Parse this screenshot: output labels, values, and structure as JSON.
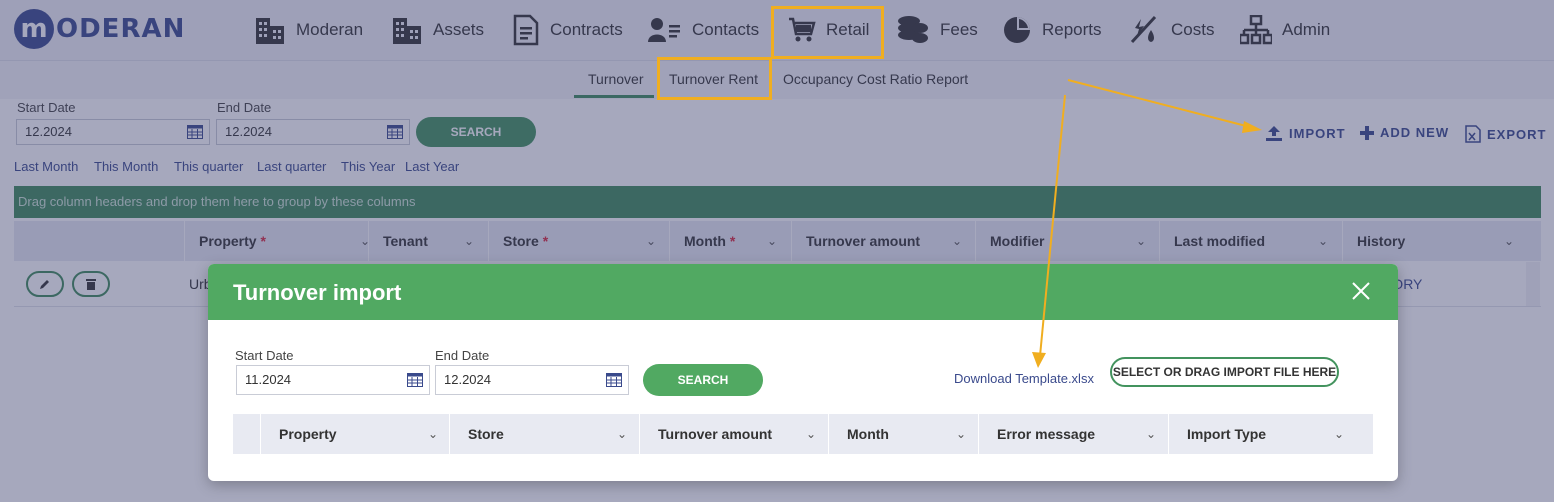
{
  "app": {
    "logo_letter": "m",
    "logo_text": "ODERAN"
  },
  "nav": {
    "items": [
      {
        "label": "Moderan",
        "icon": "building-icon"
      },
      {
        "label": "Assets",
        "icon": "building-icon"
      },
      {
        "label": "Contracts",
        "icon": "document-icon"
      },
      {
        "label": "Contacts",
        "icon": "contacts-icon"
      },
      {
        "label": "Retail",
        "icon": "cart-icon"
      },
      {
        "label": "Fees",
        "icon": "coins-icon"
      },
      {
        "label": "Reports",
        "icon": "pie-chart-icon"
      },
      {
        "label": "Costs",
        "icon": "costs-icon"
      },
      {
        "label": "Admin",
        "icon": "org-chart-icon"
      }
    ]
  },
  "subnav": {
    "tabs": [
      {
        "label": "Turnover",
        "active": true
      },
      {
        "label": "Turnover Rent"
      },
      {
        "label": "Occupancy Cost Ratio Report"
      }
    ]
  },
  "filters": {
    "start_label": "Start Date",
    "start_value": "12.2024",
    "end_label": "End Date",
    "end_value": "12.2024",
    "search_label": "SEARCH",
    "quick": [
      "Last Month",
      "This Month",
      "This quarter",
      "Last quarter",
      "This Year",
      "Last Year"
    ]
  },
  "actions": {
    "import": "IMPORT",
    "add_new": "ADD NEW",
    "export": "EXPORT"
  },
  "grid": {
    "group_hint": "Drag column headers and drop them here to group by these columns",
    "columns": [
      {
        "label": "Property",
        "required": "*"
      },
      {
        "label": "Tenant",
        "required": ""
      },
      {
        "label": "Store",
        "required": "*"
      },
      {
        "label": "Month",
        "required": "*"
      },
      {
        "label": "Turnover amount",
        "required": ""
      },
      {
        "label": "Modifier",
        "required": ""
      },
      {
        "label": "Last modified",
        "required": ""
      },
      {
        "label": "History",
        "required": ""
      }
    ],
    "row": {
      "property_partial": "Urb",
      "history_partial": "TORY"
    }
  },
  "modal": {
    "title": "Turnover import",
    "start_label": "Start Date",
    "start_value": "11.2024",
    "end_label": "End Date",
    "end_value": "12.2024",
    "search_label": "SEARCH",
    "download_link": "Download Template.xlsx",
    "select_file": "SELECT OR DRAG IMPORT FILE HERE",
    "columns": [
      "Property",
      "Store",
      "Turnover amount",
      "Month",
      "Error message",
      "Import Type"
    ]
  },
  "colors": {
    "brand": "#3a4a8c",
    "accent_green": "#51a962",
    "highlight": "#f0ae20",
    "required": "#d9263b"
  }
}
